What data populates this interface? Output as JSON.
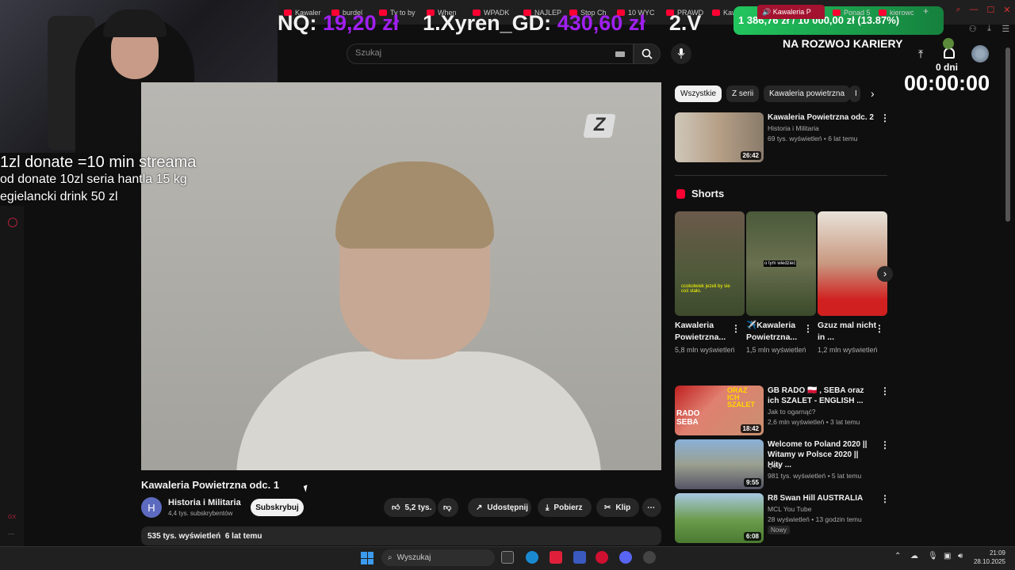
{
  "browser": {
    "tabs": [
      "Kawaler",
      "burdel",
      "Ty to by",
      "When",
      "WPADK",
      "NAJLEP",
      "Stop Ch",
      "10 WYC",
      "PRAWD",
      "Kawaler"
    ],
    "active_tab": "Kawaleria P",
    "new_tab": "+"
  },
  "overlay": {
    "banner_left_label": "NQ:",
    "banner_left_amount": "19,20 zł",
    "banner_mid_label": "1.Xyren_GD:",
    "banner_mid_amount": "430,60 zł",
    "banner_right_label": "2.V",
    "goal_text": "1 386,76 zł / 10 000,00 zł (13.87%)",
    "goal_progress": 13.87,
    "goal_tab": "Ponad 5",
    "goal_tab2": "kierowc",
    "line1": "1zl donate =10 min streama",
    "line2": "od donate 10zl seria hantla 15 kg",
    "line3": "egielancki drink 50 zl",
    "karier": "NA ROZWOJ KARIERY",
    "days": "0 dni",
    "timer": "00:00:00"
  },
  "header": {
    "search_placeholder": "Szukaj"
  },
  "video": {
    "title": "Kawaleria Powietrzna odc. 1",
    "channel": "Historia i Militaria",
    "channel_initial": "H",
    "subscribers": "4,4 tys. subskrybentów",
    "subscribe": "Subskrybuj",
    "likes": "5,2 tys.",
    "share": "Udostępnij",
    "download": "Pobierz",
    "clip": "Klip",
    "more": "⋯",
    "views": "535 tys. wyświetleń",
    "age": "6 lat temu",
    "logo_glyph": "Z"
  },
  "sidebar": {
    "chips": [
      "Wszystkie",
      "Z serii",
      "Kawaleria powietrzna",
      "I"
    ],
    "top_video": {
      "title": "Kawaleria Powietrzna  odc. 2",
      "channel": "Historia i Militaria",
      "meta": "69 tys. wyświetleń • 6 lat temu",
      "duration": "26:42"
    },
    "shorts_heading": "Shorts",
    "shorts": [
      {
        "title": "Kawaleria Powietrzna...",
        "views": "5,8 mln wyświetleń",
        "caption": "ccokolwiek jezeli by sie coś stało."
      },
      {
        "title": "✈️Kawaleria Powietrzna...",
        "views": "1,5 mln wyświetleń",
        "caption": "o tym wiedzieć"
      },
      {
        "title": "Gzuz mal nicht in ...",
        "views": "1,2 mln wyświetleń",
        "caption": ""
      }
    ],
    "videos": [
      {
        "title": "GB RADO 🇵🇱 , SEBA oraz ich SZALET - ENGLISH ...",
        "channel": "Jak to ogarnąć?",
        "meta": "2,6 mln wyświetleń • 3 lat temu",
        "duration": "18:42",
        "badge": ""
      },
      {
        "title": "Welcome to Poland 2020 || Witamy w Polsce 2020 || Hity ...",
        "channel": "Qeli",
        "meta": "981 tys. wyświetleń • 5 lat temu",
        "duration": "9:55",
        "badge": ""
      },
      {
        "title": "R8 Swan Hill AUSTRALIA",
        "channel": "MCL You Tube",
        "meta": "28 wyświetleń • 13 godzin temu",
        "duration": "6:08",
        "badge": "Nowy"
      }
    ],
    "thumb_text": {
      "oraz": "ORAZ ICH SZALET",
      "rado": "RADO SEBA"
    }
  },
  "taskbar": {
    "search": "Wyszukaj",
    "time": "21:09",
    "date": "28.10.2025"
  },
  "side_icons": {
    "gx": "GX"
  }
}
